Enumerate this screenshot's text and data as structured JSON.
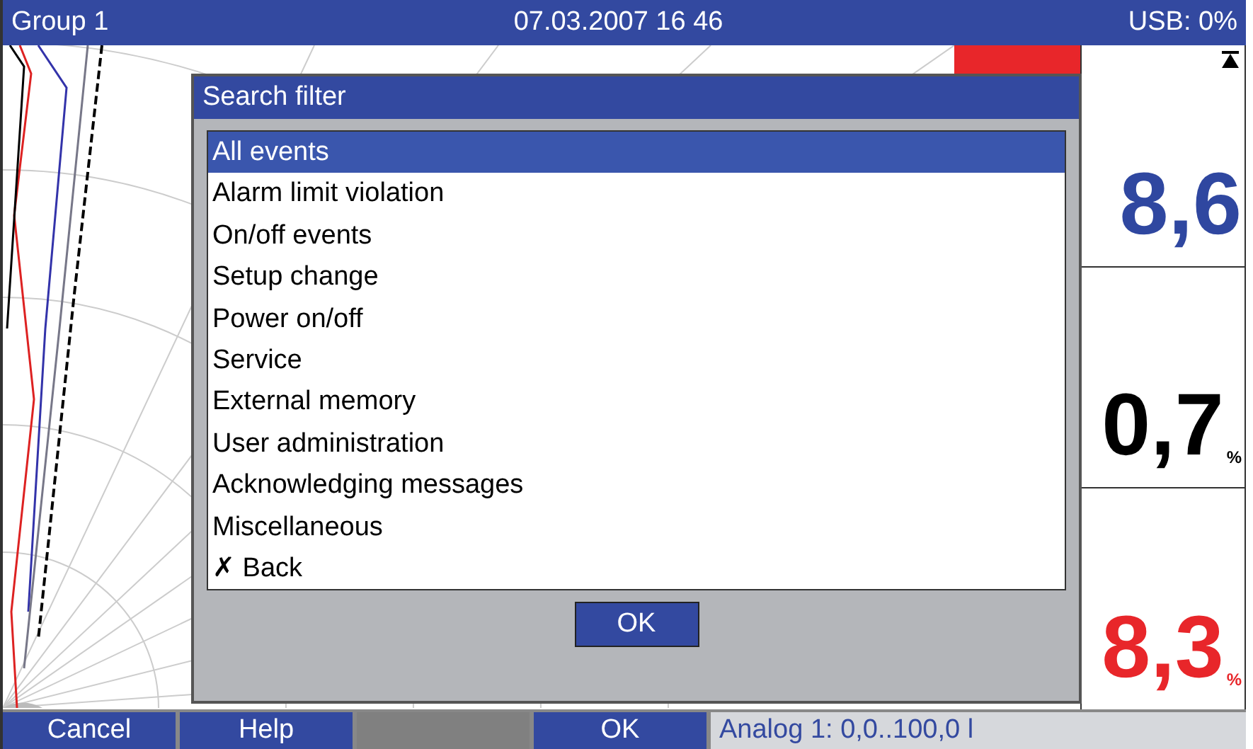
{
  "header": {
    "group": "Group 1",
    "datetime": "07.03.2007 16 46",
    "usb": "USB: 0%"
  },
  "values": [
    {
      "value": "8,6",
      "color": "#2f47a0"
    },
    {
      "value": "0,7",
      "unit": "%",
      "color": "#000000"
    },
    {
      "value": "8,3",
      "unit": "%",
      "color": "#e8262a"
    }
  ],
  "dialog": {
    "title": "Search filter",
    "items": [
      {
        "label": "All events",
        "selected": true
      },
      {
        "label": "Alarm limit violation",
        "selected": false
      },
      {
        "label": "On/off events",
        "selected": false
      },
      {
        "label": "Setup change",
        "selected": false
      },
      {
        "label": "Power on/off",
        "selected": false
      },
      {
        "label": "Service",
        "selected": false
      },
      {
        "label": "External memory",
        "selected": false
      },
      {
        "label": "User administration",
        "selected": false
      },
      {
        "label": "Acknowledging messages",
        "selected": false
      },
      {
        "label": "Miscellaneous",
        "selected": false
      },
      {
        "label": "✗ Back",
        "selected": false
      }
    ],
    "button": "OK"
  },
  "softkeys": [
    {
      "label": "Cancel",
      "disabled": false
    },
    {
      "label": "Help",
      "disabled": false
    },
    {
      "disabled": true
    },
    {
      "label": "OK",
      "disabled": false
    }
  ],
  "status": "Analog 1: 0,0..100,0 l"
}
